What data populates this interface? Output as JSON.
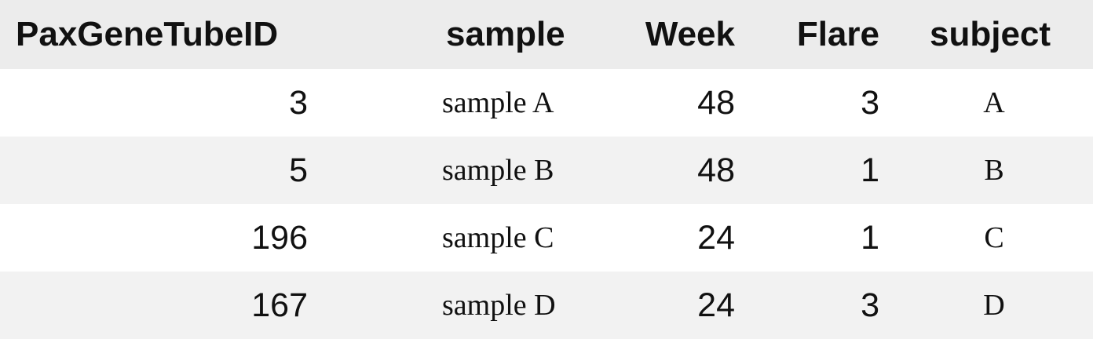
{
  "table": {
    "headers": {
      "tube_id": "PaxGeneTubeID",
      "sample": "sample",
      "week": "Week",
      "flare": "Flare",
      "subject": "subject"
    },
    "rows": [
      {
        "tube_id": "3",
        "sample": "sample A",
        "week": "48",
        "flare": "3",
        "subject": "A"
      },
      {
        "tube_id": "5",
        "sample": "sample B",
        "week": "48",
        "flare": "1",
        "subject": "B"
      },
      {
        "tube_id": "196",
        "sample": "sample C",
        "week": "24",
        "flare": "1",
        "subject": "C"
      },
      {
        "tube_id": "167",
        "sample": "sample D",
        "week": "24",
        "flare": "3",
        "subject": "D"
      }
    ]
  },
  "colors": {
    "header_bg": "#ececec",
    "row_alt_bg": "#f2f2f2",
    "row_bg": "#ffffff",
    "text": "#111111"
  }
}
